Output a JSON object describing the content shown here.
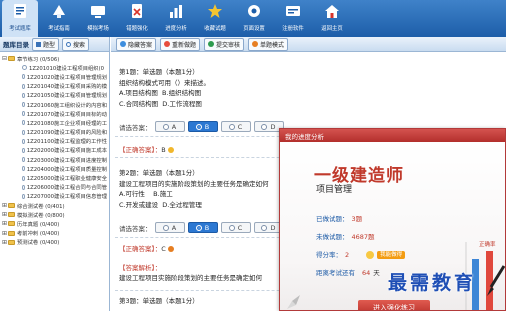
{
  "toolbar": {
    "items": [
      {
        "label": "考试题库",
        "icon": "exam-bank-icon",
        "active": true
      },
      {
        "label": "考试指南",
        "icon": "guide-icon",
        "active": false
      },
      {
        "label": "模拟考场",
        "icon": "mock-exam-icon",
        "active": false
      },
      {
        "label": "错题强化",
        "icon": "wrong-questions-icon",
        "active": false
      },
      {
        "label": "进度分析",
        "icon": "progress-analysis-icon",
        "active": false
      },
      {
        "label": "收藏试题",
        "icon": "star-icon",
        "active": false
      },
      {
        "label": "页面设置",
        "icon": "gear-icon",
        "active": false
      },
      {
        "label": "注册软件",
        "icon": "register-icon",
        "active": false
      },
      {
        "label": "返回主页",
        "icon": "home-icon",
        "active": false
      }
    ]
  },
  "left": {
    "title": "题库目录",
    "tab1": "题型",
    "tab2": "搜索",
    "tree": [
      {
        "text": "章节练习 (0/506)",
        "level": 0,
        "kind": "folder",
        "toggle": "⊟"
      },
      {
        "text": "1Z201010建设工程项目组织(0",
        "level": 1,
        "kind": "doc"
      },
      {
        "text": "1Z201020建设工程项目管理规划",
        "level": 1,
        "kind": "doc"
      },
      {
        "text": "1Z201040建设工程项目采购的模",
        "level": 1,
        "kind": "doc"
      },
      {
        "text": "1Z201050建设工程项目管理规划",
        "level": 1,
        "kind": "doc"
      },
      {
        "text": "1Z201060施工组织设计的内容和",
        "level": 1,
        "kind": "doc"
      },
      {
        "text": "1Z201070建设工程项目目标的动",
        "level": 1,
        "kind": "doc"
      },
      {
        "text": "1Z201080施工企业项目经理的工",
        "level": 1,
        "kind": "doc"
      },
      {
        "text": "1Z201090建设工程项目的风险和",
        "level": 1,
        "kind": "doc"
      },
      {
        "text": "1Z201100建设工程监理的工作性",
        "level": 1,
        "kind": "doc"
      },
      {
        "text": "1Z202000建设工程项目施工成本",
        "level": 1,
        "kind": "doc"
      },
      {
        "text": "1Z203000建设工程项目进度控制",
        "level": 1,
        "kind": "doc"
      },
      {
        "text": "1Z204000建设工程项目质量控制",
        "level": 1,
        "kind": "doc"
      },
      {
        "text": "1Z205000建设工程职业健康安全",
        "level": 1,
        "kind": "doc"
      },
      {
        "text": "1Z206000建设工程合同与合同管",
        "level": 1,
        "kind": "doc"
      },
      {
        "text": "1Z207000建设工程项目信息管理",
        "level": 1,
        "kind": "doc"
      },
      {
        "text": "综合测试卷 (0/401)",
        "level": 0,
        "kind": "folder",
        "toggle": "⊞"
      },
      {
        "text": "模拟测试卷 (0/800)",
        "level": 0,
        "kind": "folder",
        "toggle": "⊞"
      },
      {
        "text": "历年真题 (0/400)",
        "level": 0,
        "kind": "folder",
        "toggle": "⊞"
      },
      {
        "text": "考前冲刺 (0/400)",
        "level": 0,
        "kind": "folder",
        "toggle": "⊞"
      },
      {
        "text": "预测试卷 (0/400)",
        "level": 0,
        "kind": "folder",
        "toggle": "⊞"
      }
    ]
  },
  "content_bar": {
    "hide_answers": "隐藏答案",
    "redo": "重新做题",
    "submit": "提交审核",
    "single_mode": "单题模式"
  },
  "q1": {
    "title": "第1题：单选题（本题1分）",
    "stem": "组织结构模式可用（）来描述。",
    "optA": "A.项目结构图",
    "optB": "B.组织结构图",
    "optC": "C.合同结构图",
    "optD": "D.工作流程图",
    "prompt": "请选答案：",
    "choices": [
      "A",
      "B",
      "C",
      "D"
    ],
    "selected": "B",
    "correct_label": "【正确答案】：",
    "correct_value": "B"
  },
  "q2": {
    "title": "第2题：单选题（本题1分）",
    "stem": "建设工程项目的实施阶段策划的主要任务是确定如何",
    "optA": "A.可行性",
    "optB": "B.施工",
    "optC": "C.开发或建设",
    "optD": "D.全过程管理",
    "prompt": "请选答案：",
    "choices": [
      "A",
      "B",
      "C",
      "D"
    ],
    "selected": "B",
    "correct_label": "【正确答案】：",
    "correct_value": "C",
    "explain_label": "【答案解析】：",
    "explain_text": "建设工程项目实施阶段策划的主要任务是确定如何"
  },
  "q3": {
    "title": "第3题：单选题（本题1分）"
  },
  "popup": {
    "header": "我的进度分析",
    "exam_title": "一级建造师",
    "exam_subtitle": "项目管理",
    "done_label": "已做试题：",
    "done_value": "3题",
    "undone_label": "未做试题：",
    "undone_value": "4687题",
    "score_label": "得分率：",
    "score_value": "2",
    "badge": "我能做得",
    "days_label": "距离考试还有",
    "days_value": "64",
    "days_unit": "天",
    "button": "进入强化练习",
    "chart_label": "正确率"
  },
  "watermark": "最需教育"
}
